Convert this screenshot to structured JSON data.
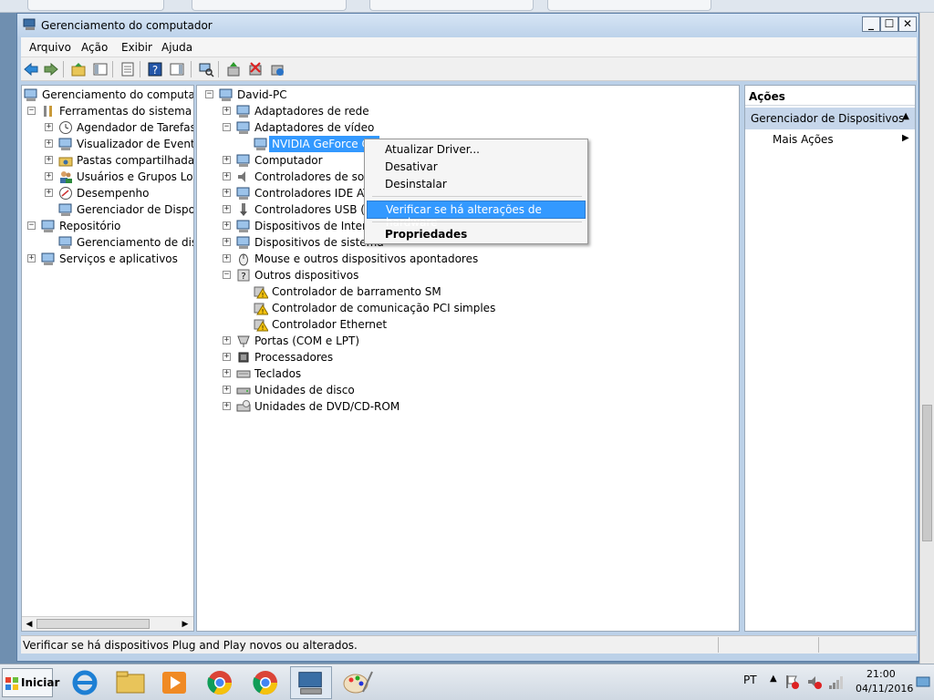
{
  "window": {
    "title": "Gerenciamento do computador",
    "min": "_",
    "max": "☐",
    "close": "✕"
  },
  "menu": [
    "Arquivo",
    "Ação",
    "Exibir",
    "Ajuda"
  ],
  "left_tree": [
    {
      "label": "Gerenciamento do computado",
      "level": 0,
      "toggle": "",
      "icon": "computer-management-icon"
    },
    {
      "label": "Ferramentas do sistema",
      "level": 1,
      "toggle": "−",
      "icon": "tools-icon"
    },
    {
      "label": "Agendador de Tarefas",
      "level": 2,
      "toggle": "+",
      "icon": "clock-icon"
    },
    {
      "label": "Visualizador de Eventos",
      "level": 2,
      "toggle": "+",
      "icon": "event-viewer-icon"
    },
    {
      "label": "Pastas compartilhadas",
      "level": 2,
      "toggle": "+",
      "icon": "shared-folder-icon"
    },
    {
      "label": "Usuários e Grupos Loca",
      "level": 2,
      "toggle": "+",
      "icon": "users-icon"
    },
    {
      "label": "Desempenho",
      "level": 2,
      "toggle": "+",
      "icon": "performance-icon"
    },
    {
      "label": "Gerenciador de Disposit",
      "level": 2,
      "toggle": "",
      "icon": "device-manager-icon"
    },
    {
      "label": "Repositório",
      "level": 1,
      "toggle": "−",
      "icon": "storage-icon"
    },
    {
      "label": "Gerenciamento de disco",
      "level": 2,
      "toggle": "",
      "icon": "disk-icon"
    },
    {
      "label": "Serviços e aplicativos",
      "level": 1,
      "toggle": "+",
      "icon": "services-icon"
    }
  ],
  "device_tree": [
    {
      "label": "David-PC",
      "level": 0,
      "toggle": "−",
      "icon": "computer-icon"
    },
    {
      "label": "Adaptadores de rede",
      "level": 1,
      "toggle": "+",
      "icon": "network-adapter-icon"
    },
    {
      "label": "Adaptadores de vídeo",
      "level": 1,
      "toggle": "−",
      "icon": "display-adapter-icon"
    },
    {
      "label": "NVIDIA GeForce GT",
      "level": 2,
      "toggle": "",
      "icon": "display-adapter-icon",
      "selected": true
    },
    {
      "label": "Computador",
      "level": 1,
      "toggle": "+",
      "icon": "computer-icon"
    },
    {
      "label": "Controladores de som,",
      "level": 1,
      "toggle": "+",
      "icon": "sound-icon"
    },
    {
      "label": "Controladores IDE ATA",
      "level": 1,
      "toggle": "+",
      "icon": "ide-icon"
    },
    {
      "label": "Controladores USB (bar",
      "level": 1,
      "toggle": "+",
      "icon": "usb-icon"
    },
    {
      "label": "Dispositivos de Interfac",
      "level": 1,
      "toggle": "+",
      "icon": "hid-icon"
    },
    {
      "label": "Dispositivos de sistema",
      "level": 1,
      "toggle": "+",
      "icon": "system-device-icon"
    },
    {
      "label": "Mouse e outros dispositivos apontadores",
      "level": 1,
      "toggle": "+",
      "icon": "mouse-icon"
    },
    {
      "label": "Outros dispositivos",
      "level": 1,
      "toggle": "−",
      "icon": "unknown-device-icon"
    },
    {
      "label": "Controlador de barramento SM",
      "level": 2,
      "toggle": "",
      "icon": "warning-device-icon"
    },
    {
      "label": "Controlador de comunicação PCI simples",
      "level": 2,
      "toggle": "",
      "icon": "warning-device-icon"
    },
    {
      "label": "Controlador Ethernet",
      "level": 2,
      "toggle": "",
      "icon": "warning-device-icon"
    },
    {
      "label": "Portas (COM e LPT)",
      "level": 1,
      "toggle": "+",
      "icon": "port-icon"
    },
    {
      "label": "Processadores",
      "level": 1,
      "toggle": "+",
      "icon": "processor-icon"
    },
    {
      "label": "Teclados",
      "level": 1,
      "toggle": "+",
      "icon": "keyboard-icon"
    },
    {
      "label": "Unidades de disco",
      "level": 1,
      "toggle": "+",
      "icon": "disk-drive-icon"
    },
    {
      "label": "Unidades de DVD/CD-ROM",
      "level": 1,
      "toggle": "+",
      "icon": "dvd-icon"
    }
  ],
  "context_menu": {
    "update_driver": "Atualizar Driver...",
    "disable": "Desativar",
    "uninstall": "Desinstalar",
    "scan_hardware": "Verificar se há alterações de hardware",
    "properties": "Propriedades"
  },
  "actions": {
    "header": "Ações",
    "section": "Gerenciador de Dispositivos",
    "more": "Mais Ações"
  },
  "status": {
    "text": "Verificar se há dispositivos Plug and Play novos ou alterados."
  },
  "taskbar": {
    "start": "Iniciar",
    "language": "PT",
    "time": "21:00",
    "date": "04/11/2016"
  },
  "colors": {
    "selection": "#3399ff",
    "actions_section_bg": "#c6d6ea",
    "window_frame": "#bcd1e8"
  }
}
